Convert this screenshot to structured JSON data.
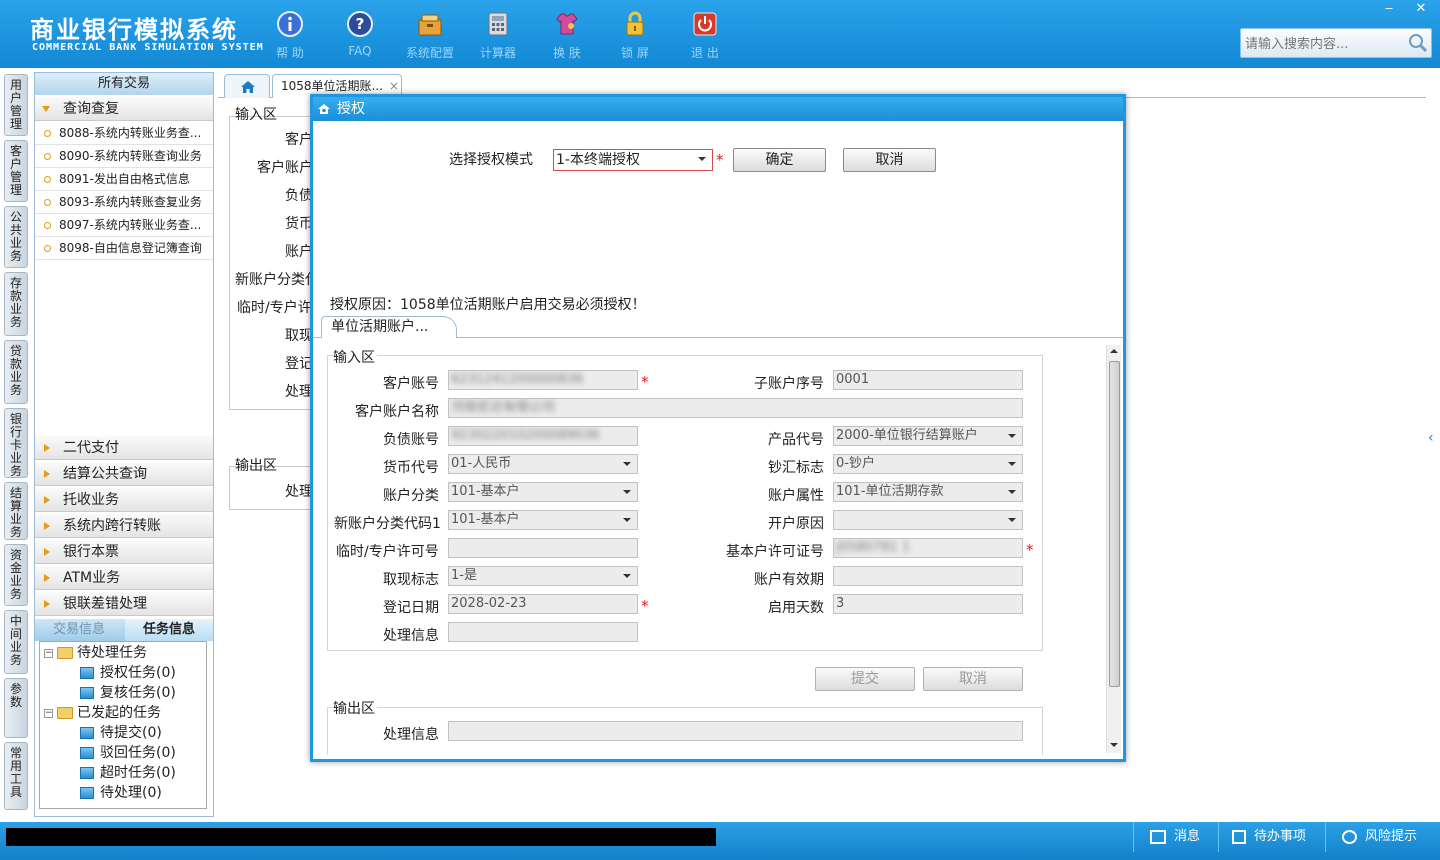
{
  "app": {
    "title_cn": "商业银行模拟系统",
    "title_en": "COMMERCIAL BANK SIMULATION SYSTEM"
  },
  "toolbar": [
    {
      "label": "帮 助",
      "icon": "info-icon"
    },
    {
      "label": "FAQ",
      "icon": "help-icon"
    },
    {
      "label": "系统配置",
      "icon": "settings-icon"
    },
    {
      "label": "计算器",
      "icon": "calculator-icon"
    },
    {
      "label": "换 肤",
      "icon": "skin-icon"
    },
    {
      "label": "锁 屏",
      "icon": "lock-icon"
    },
    {
      "label": "退 出",
      "icon": "power-icon"
    }
  ],
  "search": {
    "placeholder": "请输入搜索内容..."
  },
  "window_controls": {
    "minimize": "‒",
    "close": "✕"
  },
  "left_tabs": [
    "用户管理",
    "客户管理",
    "公共业务",
    "存款业务",
    "贷款业务",
    "银行卡业务",
    "结算业务",
    "资金业务",
    "中间业务",
    "参数",
    "常用工具"
  ],
  "nav": {
    "header": "所有交易",
    "expanded_group": "查询查复",
    "expanded_items": [
      "8088-系统内转账业务查...",
      "8090-系统内转账查询业务",
      "8091-发出自由格式信息",
      "8093-系统内转账查复业务",
      "8097-系统内转账业务查...",
      "8098-自由信息登记簿查询"
    ],
    "groups": [
      "二代支付",
      "结算公共查询",
      "托收业务",
      "系统内跨行转账",
      "银行本票",
      "ATM业务",
      "银联差错处理"
    ],
    "task_tabs": [
      "交易信息",
      "任务信息"
    ],
    "tree": {
      "pending": "待处理任务",
      "pending_items": [
        "授权任务(0)",
        "复核任务(0)"
      ],
      "initiated": "已发起的任务",
      "initiated_items": [
        "待提交(0)",
        "驳回任务(0)",
        "超时任务(0)",
        "待处理(0)"
      ]
    }
  },
  "doc_tabs": {
    "active": "1058单位活期账...",
    "close": "×"
  },
  "background_form": {
    "input_section": "输入区",
    "labels": [
      "客户",
      "客户账户",
      "负债",
      "货币",
      "账户",
      "新账户分类代",
      "临时/专户许",
      "取现",
      "登记",
      "处理"
    ],
    "output_section": "输出区",
    "output_label": "处理"
  },
  "dialog": {
    "title": "授权",
    "mode_label": "选择授权模式",
    "mode_value": "1-本终端授权",
    "confirm": "确定",
    "cancel": "取消",
    "reason": "授权原因：1058单位活期账户启用交易必须授权！",
    "inner_tab": "单位活期账户...",
    "input_section": "输入区",
    "output_section": "输出区",
    "fields": {
      "customer_account": {
        "label": "客户账号",
        "value": "6231241200000836"
      },
      "sub_account_seq": {
        "label": "子账户序号",
        "value": "0001"
      },
      "account_name": {
        "label": "客户账户名称",
        "value": "河南宏达有限公司"
      },
      "liability_account": {
        "label": "负债账号",
        "value": "923022010200089036"
      },
      "product_code": {
        "label": "产品代号",
        "value": "2000-单位银行结算账户"
      },
      "currency_code": {
        "label": "货币代号",
        "value": "01-人民币"
      },
      "cash_flag": {
        "label": "钞汇标志",
        "value": "0-钞户"
      },
      "account_class": {
        "label": "账户分类",
        "value": "101-基本户"
      },
      "account_attr": {
        "label": "账户属性",
        "value": "101-单位活期存款"
      },
      "new_class_code": {
        "label": "新账户分类代码1",
        "value": "101-基本户"
      },
      "open_reason": {
        "label": "开户原因",
        "value": ""
      },
      "temp_permit": {
        "label": "临时/专户许可号",
        "value": ""
      },
      "basic_permit": {
        "label": "基本户许可证号",
        "value": "J0580781 1"
      },
      "withdraw_flag": {
        "label": "取现标志",
        "value": "1-是"
      },
      "validity": {
        "label": "账户有效期",
        "value": ""
      },
      "reg_date": {
        "label": "登记日期",
        "value": "2028-02-23"
      },
      "enable_days": {
        "label": "启用天数",
        "value": "3"
      },
      "process_info": {
        "label": "处理信息",
        "value": ""
      },
      "output_process_info": {
        "label": "处理信息",
        "value": ""
      }
    },
    "submit": "提交",
    "cancel2": "取消",
    "required_mark": "*"
  },
  "statusbar": {
    "messages": "消息",
    "todo": "待办事项",
    "risk": "风险提示"
  },
  "colors": {
    "brand_blue": "#1e8fd6",
    "accent_orange": "#e69a16",
    "required_red": "#d81e1e"
  }
}
